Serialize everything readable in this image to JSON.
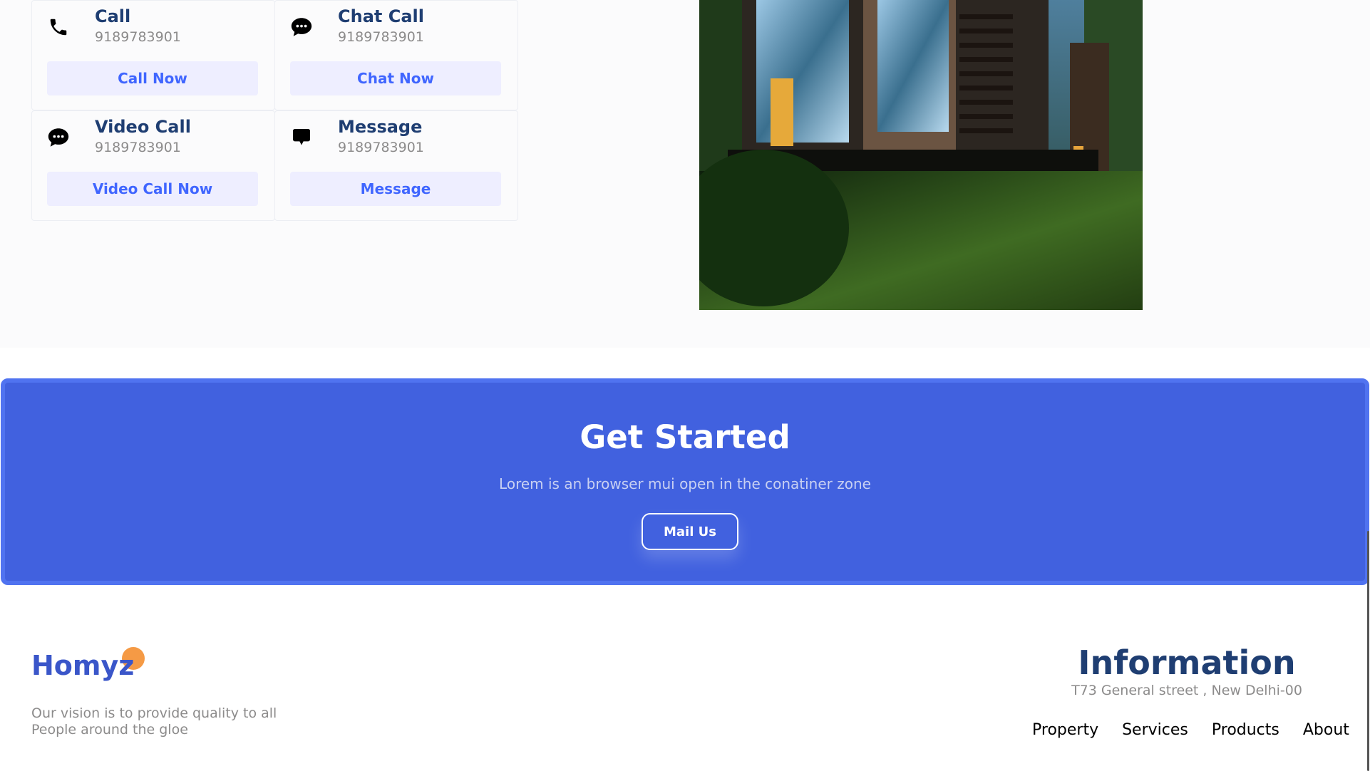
{
  "contact": {
    "cards": [
      {
        "title": "Call",
        "number": "9189783901",
        "button": "Call Now",
        "icon": "phone-icon"
      },
      {
        "title": "Chat Call",
        "number": "9189783901",
        "button": "Chat Now",
        "icon": "chat-bubble-icon"
      },
      {
        "title": "Video Call",
        "number": "9189783901",
        "button": "Video Call Now",
        "icon": "video-chat-icon"
      },
      {
        "title": "Message",
        "number": "9189783901",
        "button": "Message",
        "icon": "message-icon"
      }
    ]
  },
  "banner": {
    "heading": "Get Started",
    "subtitle": "Lorem is an browser mui open in the conatiner zone",
    "button": "Mail Us"
  },
  "footer": {
    "brand": "Homyz",
    "vision_line1": "Our vision is to provide quality to all",
    "vision_line2": "People around the gloe",
    "info_title": "Information",
    "address": "T73 General street , New Delhi-00",
    "nav": [
      "Property",
      "Services",
      "Products",
      "About"
    ]
  },
  "colors": {
    "accent": "#4161df",
    "button_bg": "#eeeeff",
    "button_text": "#4066ff",
    "heading": "#1f3e72",
    "muted": "#8c8b8b",
    "brand_dot": "#f59a45"
  }
}
